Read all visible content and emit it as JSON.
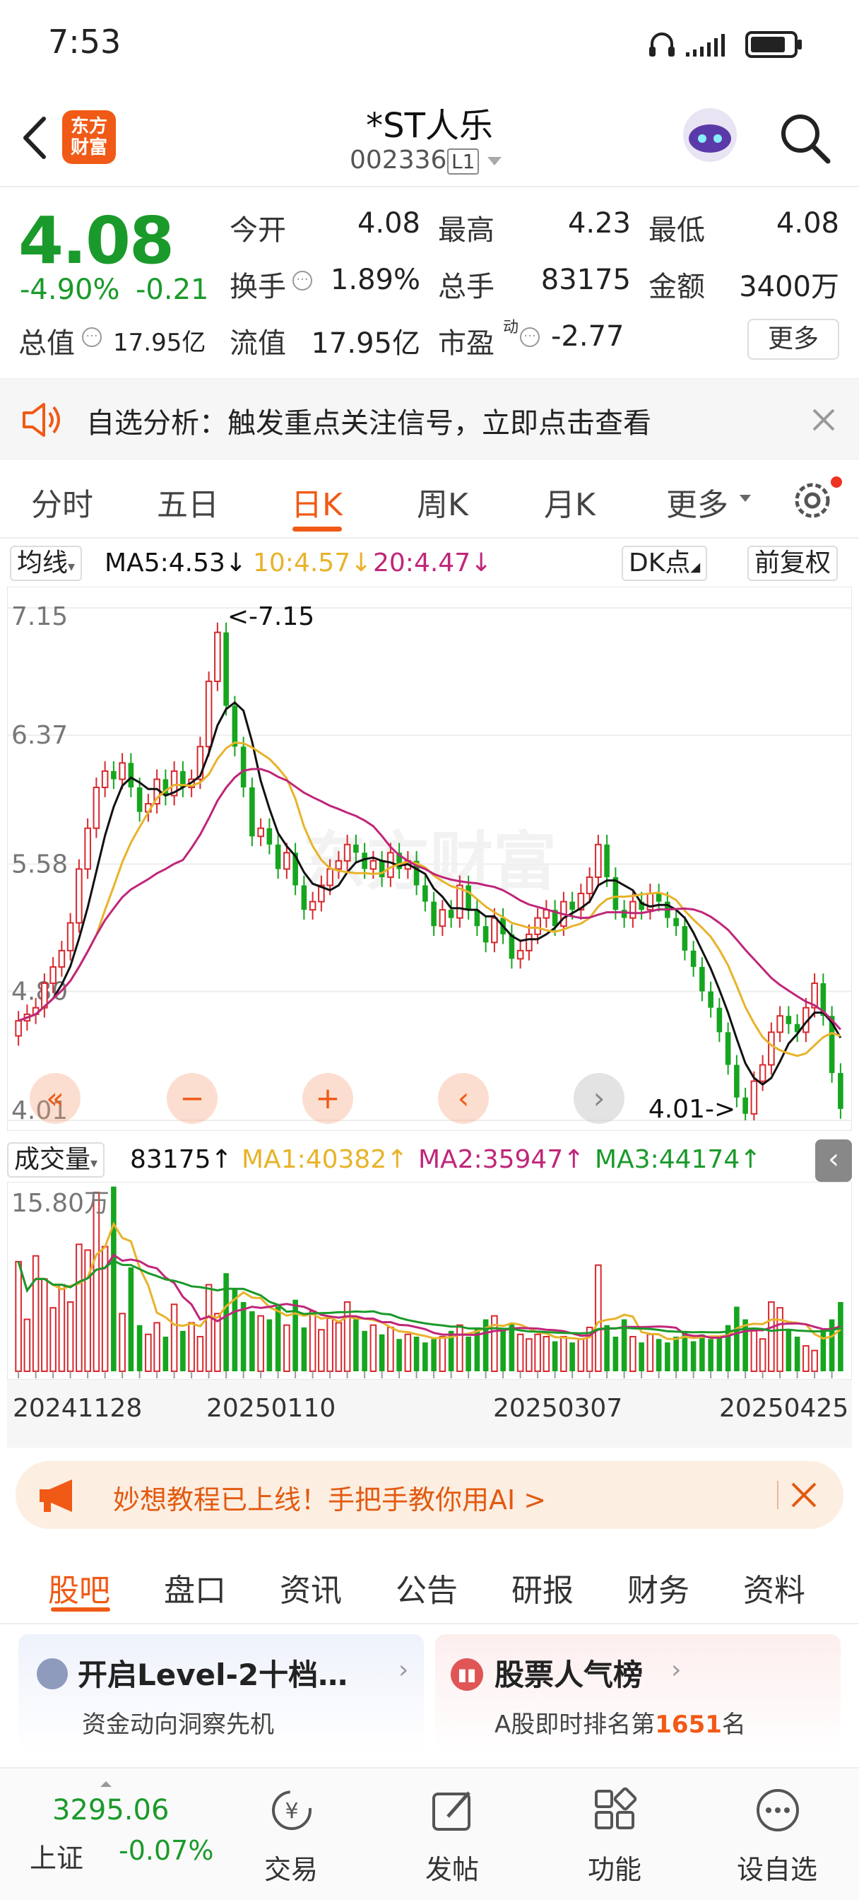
{
  "status": {
    "time": "7:53"
  },
  "header": {
    "logo_line1": "东方",
    "logo_line2": "财富",
    "title": "*ST人乐",
    "code": "002336",
    "level": "L1"
  },
  "quote": {
    "price": "4.08",
    "change_pct": "-4.90%",
    "change": "-0.21",
    "open_label": "今开",
    "open": "4.08",
    "high_label": "最高",
    "high": "4.23",
    "low_label": "最低",
    "low": "4.08",
    "turnover_label": "换手",
    "turnover": "1.89%",
    "volume_label": "总手",
    "volume": "83175",
    "amount_label": "金额",
    "amount": "3400万",
    "mktcap_label": "总值",
    "mktcap": "17.95亿",
    "float_label": "流值",
    "float_cap": "17.95亿",
    "pe_label": "市盈",
    "pe_sup": "动",
    "pe": "-2.77",
    "more": "更多"
  },
  "alert": {
    "text": "自选分析：触发重点关注信号，立即点击查看"
  },
  "chart_tabs": [
    "分时",
    "五日",
    "日K",
    "周K",
    "月K",
    "更多"
  ],
  "ma_bar": {
    "selector": "均线",
    "ma5": "MA5:4.53↓",
    "ma10": "10:4.57↓",
    "ma20": "20:4.47↓",
    "dk": "DK点",
    "adjust": "前复权"
  },
  "watermark": "东方财富",
  "chart_data": {
    "type": "candlestick",
    "y_ticks": [
      "7.15",
      "6.37",
      "5.58",
      "4.80",
      "4.01"
    ],
    "ylim": [
      4.01,
      7.15
    ],
    "max_label": "<-7.15",
    "min_label": "4.01->",
    "x_ticks": [
      "20241128",
      "20250110",
      "20250307",
      "20250425"
    ],
    "series": [
      {
        "name": "MA5",
        "color": "#111111"
      },
      {
        "name": "MA10",
        "color": "#e8b32a"
      },
      {
        "name": "MA20",
        "color": "#c0267a"
      }
    ],
    "closes": [
      4.62,
      4.66,
      4.7,
      4.85,
      4.95,
      5.05,
      5.22,
      5.55,
      5.8,
      6.05,
      6.15,
      6.1,
      6.2,
      6.05,
      5.9,
      5.95,
      6.1,
      6.0,
      6.15,
      6.05,
      6.1,
      6.3,
      6.7,
      7.0,
      6.55,
      6.3,
      6.05,
      5.75,
      5.8,
      5.7,
      5.55,
      5.65,
      5.45,
      5.3,
      5.35,
      5.45,
      5.55,
      5.6,
      5.7,
      5.65,
      5.55,
      5.6,
      5.5,
      5.65,
      5.55,
      5.6,
      5.45,
      5.35,
      5.2,
      5.3,
      5.25,
      5.45,
      5.3,
      5.2,
      5.1,
      5.25,
      5.15,
      5.0,
      5.05,
      5.15,
      5.25,
      5.3,
      5.2,
      5.35,
      5.3,
      5.4,
      5.5,
      5.7,
      5.5,
      5.3,
      5.25,
      5.35,
      5.3,
      5.4,
      5.35,
      5.25,
      5.2,
      5.05,
      4.95,
      4.8,
      4.7,
      4.55,
      4.35,
      4.15,
      4.05,
      4.25,
      4.35,
      4.55,
      4.65,
      4.6,
      4.55,
      4.7,
      4.85,
      4.65,
      4.3,
      4.08
    ],
    "volume": {
      "label": "成交量",
      "current": "83175↑",
      "ma1": "MA1:40382↑",
      "ma2": "MA2:35947↑",
      "ma3": "MA3:44174↑",
      "max_label": "15.80万",
      "ylim": [
        0,
        158000
      ],
      "values": [
        95000,
        45000,
        100000,
        80000,
        55000,
        75000,
        60000,
        110000,
        105000,
        155000,
        108000,
        160000,
        50000,
        90000,
        40000,
        32000,
        42000,
        30000,
        58000,
        35000,
        42000,
        30000,
        75000,
        50000,
        85000,
        72000,
        60000,
        52000,
        48000,
        45000,
        56000,
        40000,
        62000,
        38000,
        52000,
        36000,
        46000,
        42000,
        60000,
        45000,
        35000,
        40000,
        32000,
        38000,
        28000,
        32000,
        30000,
        25000,
        28000,
        30000,
        35000,
        40000,
        30000,
        38000,
        45000,
        48000,
        35000,
        42000,
        32000,
        28000,
        32000,
        30000,
        26000,
        30000,
        25000,
        28000,
        38000,
        92000,
        40000,
        30000,
        45000,
        30000,
        25000,
        32000,
        28000,
        25000,
        30000,
        35000,
        26000,
        32000,
        28000,
        30000,
        40000,
        56000,
        45000,
        35000,
        28000,
        60000,
        55000,
        36000,
        30000,
        22000,
        18000,
        36000,
        45000,
        60000
      ]
    }
  },
  "chart_controls": [
    "«",
    "−",
    "+",
    "‹",
    "›"
  ],
  "promo": {
    "text": "妙想教程已上线！手把手教你用AI >"
  },
  "bottom_tabs": [
    "股吧",
    "盘口",
    "资讯",
    "公告",
    "研报",
    "财务",
    "资料"
  ],
  "cards": [
    {
      "title": "开启Level-2十档…",
      "subtitle": "资金动向洞察先机"
    },
    {
      "title": "股票人气榜",
      "sub_prefix": "A股即时排名第",
      "rank": "1651",
      "sub_suffix": "名"
    }
  ],
  "index": {
    "value": "3295.06",
    "name": "上证",
    "change": "-0.07%"
  },
  "nav": [
    "交易",
    "发帖",
    "功能",
    "设自选"
  ]
}
